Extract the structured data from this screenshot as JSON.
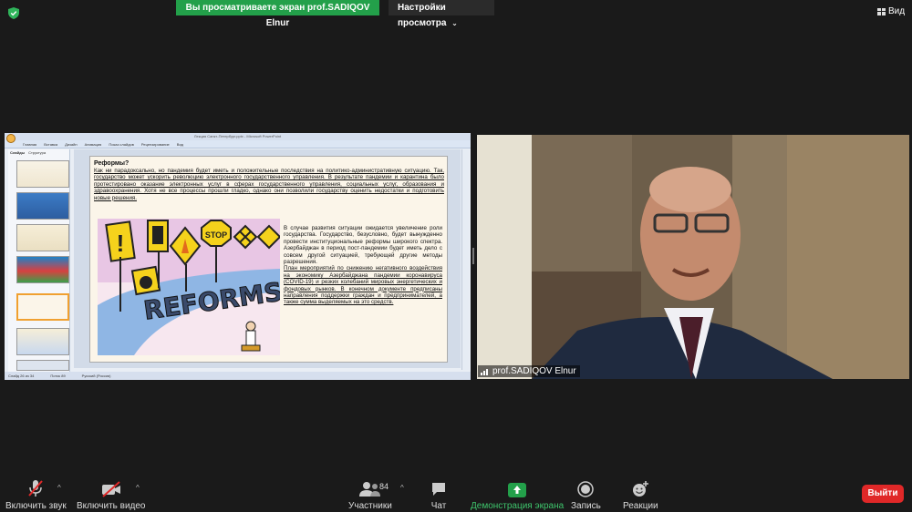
{
  "top": {
    "banner_text": "Вы просматриваете экран prof.SADIQOV Elnur",
    "view_options_label": "Настройки просмотра",
    "view_label": "Вид"
  },
  "shared_screen": {
    "window_title": "Лекция Санкт-Петербург.pptx - Microsoft PowerPoint",
    "ribbon_tabs": [
      "Главная",
      "Вставка",
      "Дизайн",
      "Анимация",
      "Показ слайдов",
      "Рецензирование",
      "Вид"
    ],
    "side_tabs": [
      "Слайды",
      "Структура"
    ],
    "status": [
      "Слайд 26 из 34",
      "Поток 89",
      "Русский (Россия)"
    ],
    "slide": {
      "title": "Реформы?",
      "intro": "Как ни парадоксально, но пандемия будет иметь и положительные последствия на политико-административную ситуацию. Так, государство может ускорить революцию электронного государственного управления. В результате пандемии и карантина было протестировано оказание электронных услуг в сферах государственного управления, социальных услуг, образования и здравоохранения. Хотя не все процессы прошли гладко, однако они позволили государству оценить недостатки и подготовить новые решения.",
      "body_p1": "В случае развития ситуации ожидается увеличение роли государства. Государство, безусловно, будет вынужденно провести институциональные реформы широкого спектра. Азербайджан в период пост-пандемии будет иметь дело с совсем другой ситуацией, требующей другие методы разрешения.",
      "body_p2": "План мероприятий по снижению негативного воздействия на экономику Азербайджана пандемии коронавируса (COVID-19) и резких колебаний мировых энергетических и фондовых рынков. В конечном документе предписаны направления поддержки граждан и предпринимателей, а также сумма выделяемых на это средств.",
      "image_caption": "REFORMS",
      "stop_sign": "STOP"
    }
  },
  "video": {
    "participant_name": "prof.SADIQOV Elnur"
  },
  "controls": {
    "mute_label": "Включить звук",
    "video_label": "Включить видео",
    "participants_label": "Участники",
    "participants_count": "84",
    "chat_label": "Чат",
    "share_label": "Демонстрация экрана",
    "record_label": "Запись",
    "reactions_label": "Реакции",
    "leave_label": "Выйти"
  },
  "colors": {
    "share_green": "#23a04a",
    "leave_red": "#e02828",
    "background": "#1a1a1a"
  }
}
